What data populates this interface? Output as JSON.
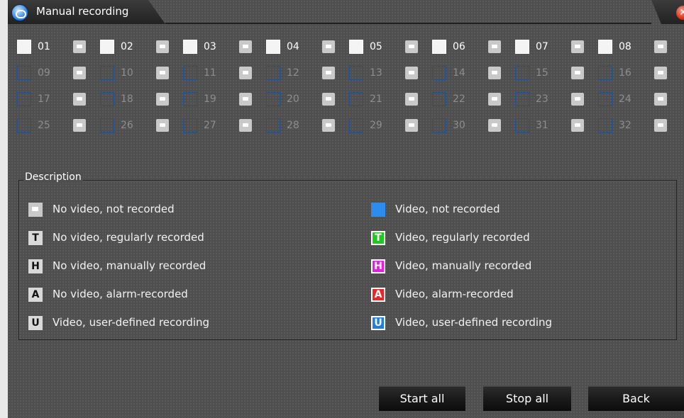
{
  "window": {
    "title": "Manual recording"
  },
  "channels": [
    {
      "num": "01",
      "enabled": true
    },
    {
      "num": "02",
      "enabled": true
    },
    {
      "num": "03",
      "enabled": true
    },
    {
      "num": "04",
      "enabled": true
    },
    {
      "num": "05",
      "enabled": true
    },
    {
      "num": "06",
      "enabled": true
    },
    {
      "num": "07",
      "enabled": true
    },
    {
      "num": "08",
      "enabled": true
    },
    {
      "num": "09",
      "enabled": false
    },
    {
      "num": "10",
      "enabled": false
    },
    {
      "num": "11",
      "enabled": false
    },
    {
      "num": "12",
      "enabled": false
    },
    {
      "num": "13",
      "enabled": false
    },
    {
      "num": "14",
      "enabled": false
    },
    {
      "num": "15",
      "enabled": false
    },
    {
      "num": "16",
      "enabled": false
    },
    {
      "num": "17",
      "enabled": false
    },
    {
      "num": "18",
      "enabled": false
    },
    {
      "num": "19",
      "enabled": false
    },
    {
      "num": "20",
      "enabled": false
    },
    {
      "num": "21",
      "enabled": false
    },
    {
      "num": "22",
      "enabled": false
    },
    {
      "num": "23",
      "enabled": false
    },
    {
      "num": "24",
      "enabled": false
    },
    {
      "num": "25",
      "enabled": false
    },
    {
      "num": "26",
      "enabled": false
    },
    {
      "num": "27",
      "enabled": false
    },
    {
      "num": "28",
      "enabled": false
    },
    {
      "num": "29",
      "enabled": false
    },
    {
      "num": "30",
      "enabled": false
    },
    {
      "num": "31",
      "enabled": false
    },
    {
      "num": "32",
      "enabled": false
    }
  ],
  "description": {
    "title": "Description",
    "left": [
      {
        "icon": "no-video-icon",
        "letter": "",
        "text": "No video, not recorded"
      },
      {
        "icon": "regular-record-icon",
        "letter": "T",
        "text": "No video, regularly recorded"
      },
      {
        "icon": "manual-record-icon",
        "letter": "H",
        "text": "No video, manually recorded"
      },
      {
        "icon": "alarm-record-icon",
        "letter": "A",
        "text": "No video, alarm-recorded"
      },
      {
        "icon": "user-defined-icon",
        "letter": "U",
        "text": "Video, user-defined recording"
      }
    ],
    "right": [
      {
        "icon": "video-icon",
        "letter": "",
        "text": "Video, not recorded",
        "color": "#2d8cf0"
      },
      {
        "icon": "regular-record-icon",
        "letter": "T",
        "text": "Video, regularly recorded",
        "color": "#23c623"
      },
      {
        "icon": "manual-record-icon",
        "letter": "H",
        "text": "Video, manually recorded",
        "color": "#e61ee6"
      },
      {
        "icon": "alarm-record-icon",
        "letter": "A",
        "text": "Video, alarm-recorded",
        "color": "#e82828"
      },
      {
        "icon": "user-defined-icon",
        "letter": "U",
        "text": "Video, user-defined recording",
        "color": "#1e7fe0"
      }
    ]
  },
  "buttons": {
    "start_all": "Start all",
    "stop_all": "Stop all",
    "back": "Back"
  }
}
